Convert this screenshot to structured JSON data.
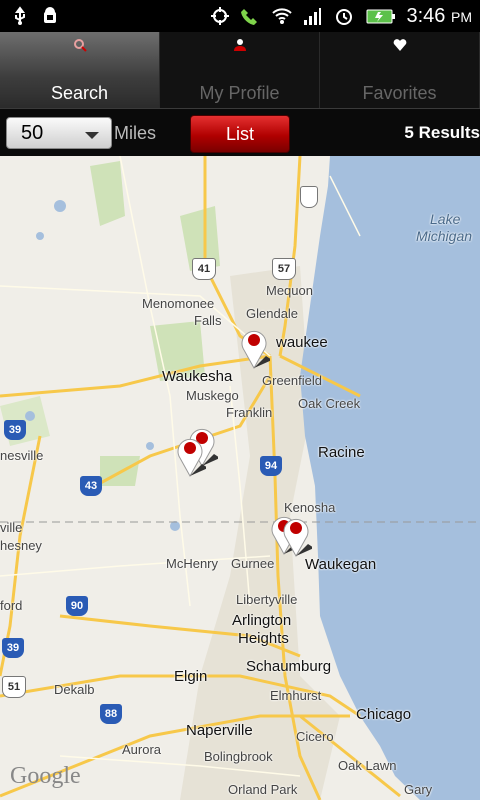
{
  "status_bar": {
    "time": "3:46",
    "ampm": "PM",
    "icons": [
      "usb-icon",
      "android-debug-icon",
      "gps-icon",
      "phone-icon",
      "wifi-icon",
      "signal-icon",
      "alarm-icon",
      "battery-icon"
    ]
  },
  "tabs": [
    {
      "label": "Search",
      "icon": "search-icon",
      "active": true
    },
    {
      "label": "My Profile",
      "icon": "profile-icon",
      "active": false
    },
    {
      "label": "Favorites",
      "icon": "heart-icon",
      "active": false
    }
  ],
  "toolbar": {
    "radius_value": "50",
    "radius_unit": "Miles",
    "list_label": "List",
    "results_text": "5 Results"
  },
  "map": {
    "attribution": "Google",
    "labels": {
      "lake_michigan_1": "Lake",
      "lake_michigan_2": "Michigan",
      "glendale": "Glendale",
      "mequon": "Mequon",
      "menomonee_falls_1": "Menomonee",
      "menomonee_falls_2": "Falls",
      "milwaukee": "waukee",
      "waukesha": "Waukesha",
      "greenfield": "Greenfield",
      "muskego": "Muskego",
      "oak_creek": "Oak Creek",
      "franklin": "Franklin",
      "racine": "Racine",
      "janesville": "nesville",
      "kenosha": "Kenosha",
      "mchenry": "McHenry",
      "gurnee": "Gurnee",
      "waukegan": "Waukegan",
      "libertyville": "Libertyville",
      "arlington_1": "Arlington",
      "arlington_2": "Heights",
      "schaumburg": "Schaumburg",
      "elgin": "Elgin",
      "elmhurst": "Elmhurst",
      "dekalb": "Dekalb",
      "chicago": "Chicago",
      "cicero": "Cicero",
      "naperville": "Naperville",
      "aurora": "Aurora",
      "bolingbrook": "Bolingbrook",
      "orland_park": "Orland Park",
      "oak_lawn": "Oak Lawn",
      "gary": "Gary",
      "belvidere": "ford",
      "chesney": "hesney",
      "rockton": "ville"
    },
    "shields": {
      "i41": "41",
      "i57": "57",
      "i43": "43",
      "i94": "94",
      "i39a": "39",
      "i90": "90",
      "i39b": "39",
      "i88": "88",
      "i51": "51"
    }
  },
  "colors": {
    "accent_red": "#c00000",
    "water": "#a5bfdd",
    "road_major": "#f7c84a",
    "urban": "#e6e2d6"
  }
}
